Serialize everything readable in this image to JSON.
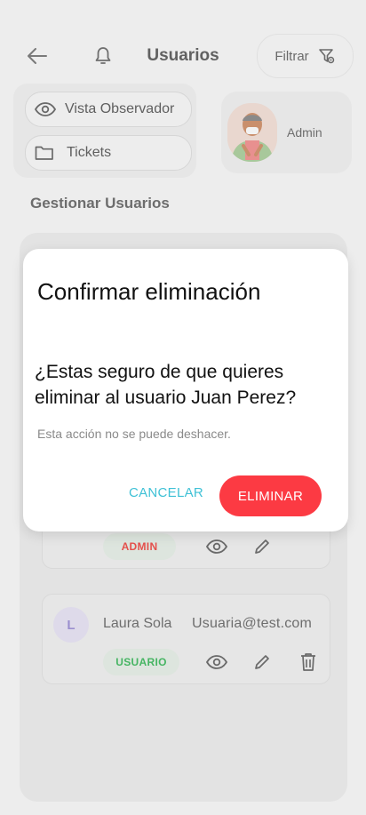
{
  "header": {
    "title": "Usuarios",
    "filter_label": "Filtrar"
  },
  "options": {
    "observer_label": "Vista Observador",
    "tickets_label": "Tickets"
  },
  "profile": {
    "name": "Admin"
  },
  "section_title": "Gestionar Usuarios",
  "users": [
    {
      "role": "ADMIN",
      "role_color": "#e5504c"
    },
    {
      "initial": "L",
      "name": "Laura Sola",
      "email": "Usuaria@test.com",
      "role": "USUARIO",
      "role_color": "#46b563"
    }
  ],
  "dialog": {
    "title": "Confirmar eliminación",
    "message": "¿Estas seguro de que quieres eliminar al usuario Juan Perez?",
    "note": "Esta acción no se puede deshacer.",
    "cancel_label": "CANCELAR",
    "delete_label": "ELIMINAR"
  },
  "colors": {
    "accent": "#3fc1d6",
    "danger": "#fc3a43"
  }
}
